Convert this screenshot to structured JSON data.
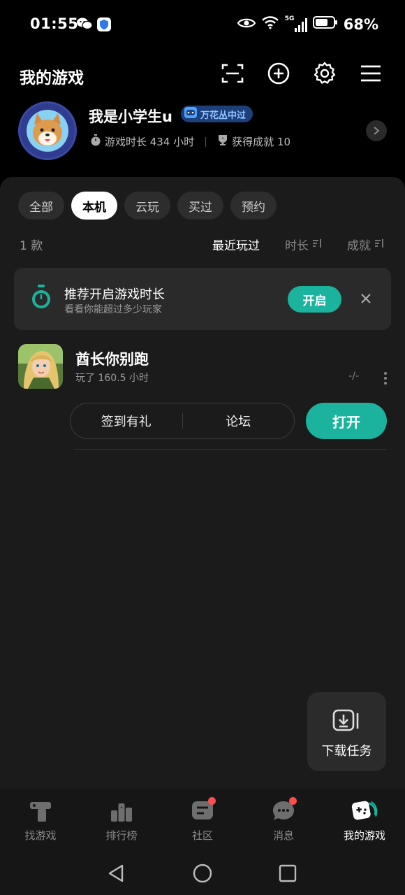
{
  "status_bar": {
    "time": "01:55",
    "battery": "68%",
    "network": "5G"
  },
  "header": {
    "title": "我的游戏"
  },
  "profile": {
    "username": "我是小学生u",
    "badge": "万花丛中过",
    "play_time": "游戏时长 434 小时",
    "achievements": "获得成就 10"
  },
  "filters": {
    "tabs": [
      {
        "label": "全部"
      },
      {
        "label": "本机",
        "active": true
      },
      {
        "label": "云玩"
      },
      {
        "label": "买过"
      },
      {
        "label": "预约"
      }
    ]
  },
  "sort": {
    "count": "1 款",
    "options": [
      {
        "label": "最近玩过",
        "active": true
      },
      {
        "label": "时长"
      },
      {
        "label": "成就"
      }
    ]
  },
  "banner": {
    "title": "推荐开启游戏时长",
    "subtitle": "看看你能超过多少玩家",
    "button": "开启"
  },
  "game": {
    "name": "酋长你别跑",
    "play_time": "玩了 160.5 小时",
    "achievement": "-/-",
    "actions": [
      "签到有礼",
      "论坛"
    ],
    "open_label": "打开"
  },
  "download_fab": {
    "label": "下载任务"
  },
  "bottom_nav": [
    {
      "label": "找游戏",
      "icon": "find-game-icon"
    },
    {
      "label": "排行榜",
      "icon": "ranking-icon"
    },
    {
      "label": "社区",
      "icon": "community-icon",
      "dot": true
    },
    {
      "label": "消息",
      "icon": "message-icon",
      "dot": true
    },
    {
      "label": "我的游戏",
      "icon": "my-games-icon",
      "active": true
    }
  ],
  "colors": {
    "accent": "#1bb39d",
    "badge_bg": "#1d3f7a",
    "notification": "#ff4d4d"
  }
}
